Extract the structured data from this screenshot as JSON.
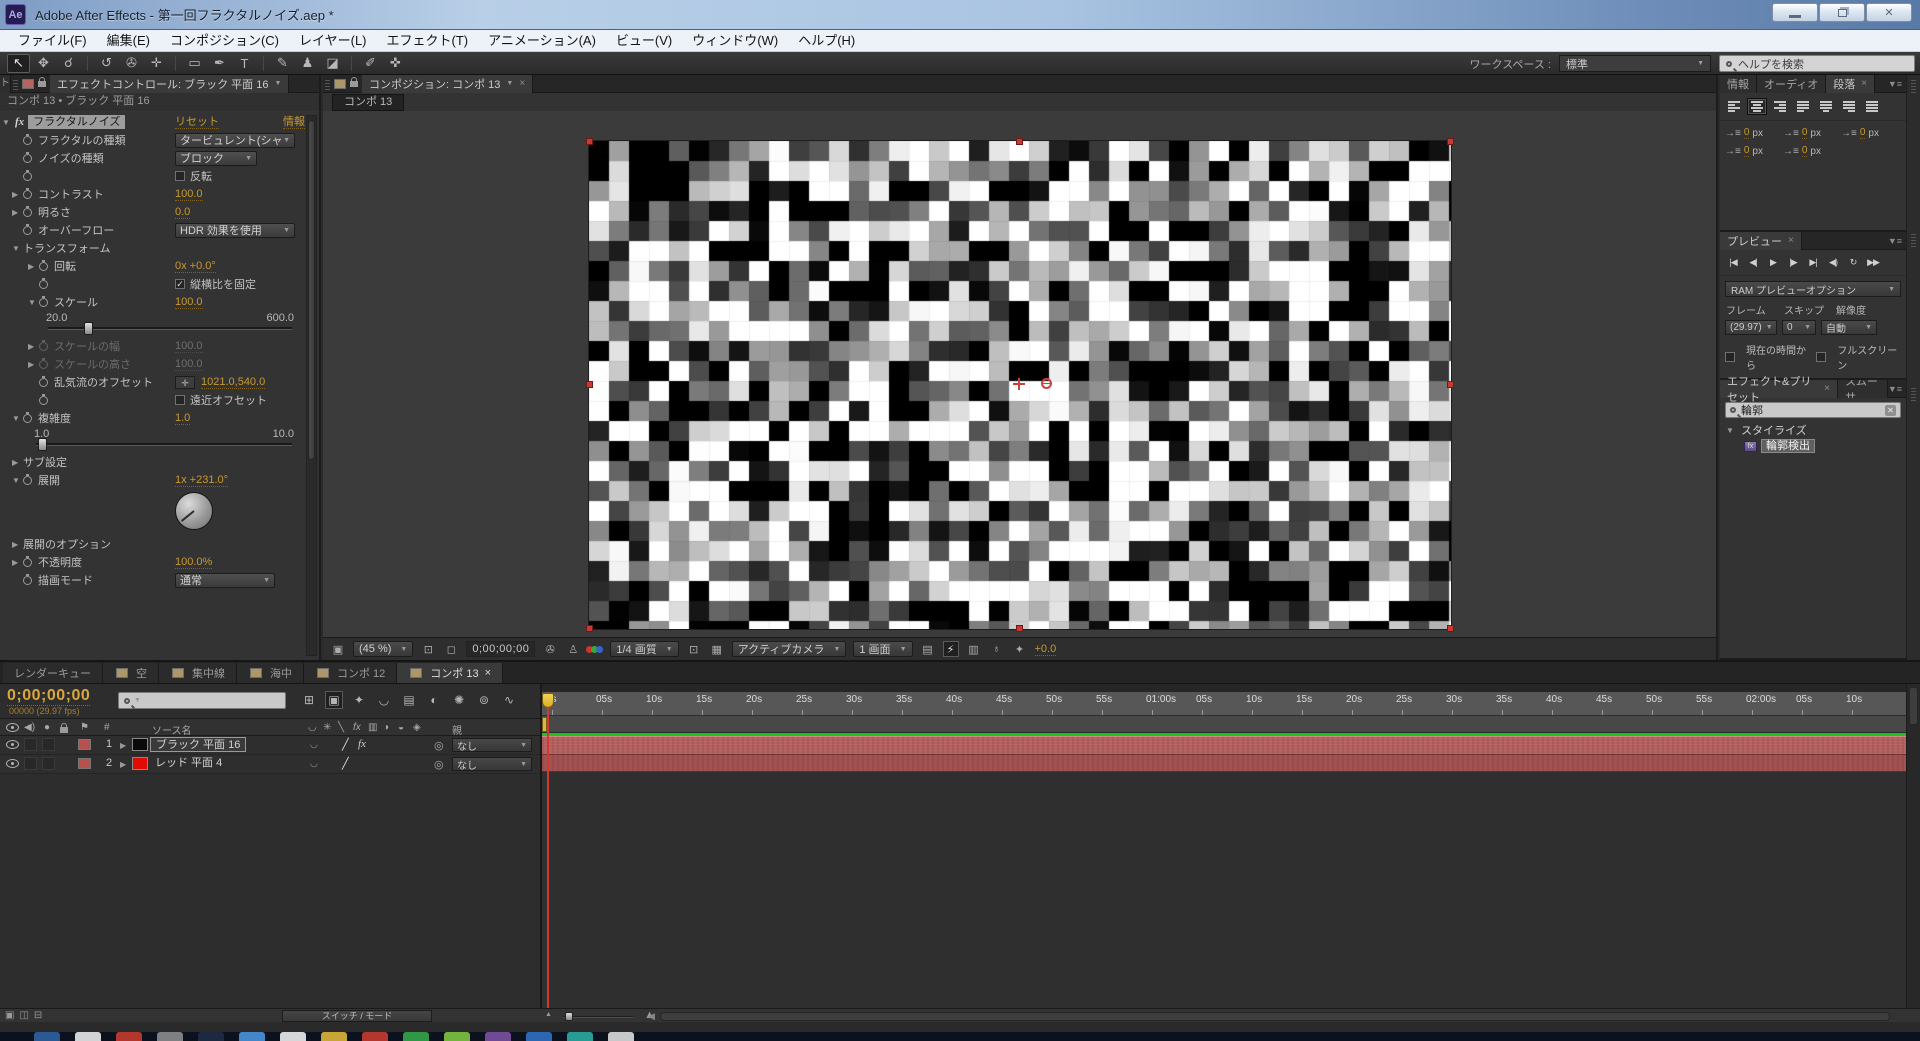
{
  "window": {
    "title": "Adobe After Effects - 第一回フラクタルノイズ.aep *"
  },
  "menu": {
    "items": [
      {
        "name": "menu-file",
        "label": "ファイル(F)"
      },
      {
        "name": "menu-edit",
        "label": "編集(E)"
      },
      {
        "name": "menu-composition",
        "label": "コンポジション(C)"
      },
      {
        "name": "menu-layer",
        "label": "レイヤー(L)"
      },
      {
        "name": "menu-effect",
        "label": "エフェクト(T)"
      },
      {
        "name": "menu-animation",
        "label": "アニメーション(A)"
      },
      {
        "name": "menu-view",
        "label": "ビュー(V)"
      },
      {
        "name": "menu-window",
        "label": "ウィンドウ(W)"
      },
      {
        "name": "menu-help",
        "label": "ヘルプ(H)"
      }
    ]
  },
  "toolbar": {
    "tools": [
      {
        "name": "selection-tool",
        "glyph": "↖",
        "active": true
      },
      {
        "name": "hand-tool",
        "glyph": "✥"
      },
      {
        "name": "zoom-tool",
        "glyph": "☌"
      },
      {
        "name": "rotation-tool",
        "glyph": "↺"
      },
      {
        "name": "unified-camera-tool",
        "glyph": "✇"
      },
      {
        "name": "pan-behind-tool",
        "glyph": "✛"
      },
      {
        "name": "shape-tool",
        "glyph": "▭"
      },
      {
        "name": "pen-tool",
        "glyph": "✒"
      },
      {
        "name": "type-tool",
        "glyph": "T"
      },
      {
        "name": "brush-tool",
        "glyph": "✎"
      },
      {
        "name": "clone-stamp-tool",
        "glyph": "♟"
      },
      {
        "name": "eraser-tool",
        "glyph": "◪"
      },
      {
        "name": "roto-brush-tool",
        "glyph": "✐"
      },
      {
        "name": "puppet-pin-tool",
        "glyph": "✜"
      }
    ],
    "workspace_label": "ワークスペース :",
    "workspace_value": "標準",
    "help_search_placeholder": "ヘルプを検索"
  },
  "ec": {
    "project_tab_fragment": "ト",
    "tab": "エフェクトコントロール: ブラック 平面 16",
    "breadcrumb": "コンポ 13 • ブラック 平面 16",
    "fx_badge": "fx",
    "effect_name": "フラクタルノイズ",
    "reset": "リセット",
    "about": "情報",
    "rows": {
      "fractal_type": {
        "label": "フラクタルの種類",
        "value": "タービュレント(シャ"
      },
      "noise_type": {
        "label": "ノイズの種類",
        "value": "ブロック"
      },
      "invert": {
        "label": "反転"
      },
      "contrast": {
        "label": "コントラスト",
        "value": "100.0"
      },
      "brightness": {
        "label": "明るさ",
        "value": "0.0"
      },
      "overflow": {
        "label": "オーバーフロー",
        "value": "HDR 効果を使用"
      },
      "transform": {
        "label": "トランスフォーム"
      },
      "rotation": {
        "label": "回転",
        "value": "0x +0.0°"
      },
      "aspect": {
        "label": "縦横比を固定"
      },
      "scale": {
        "label": "スケール",
        "value": "100.0",
        "min": "20.0",
        "max": "600.0"
      },
      "scale_width": {
        "label": "スケールの幅",
        "value": "100.0"
      },
      "scale_height": {
        "label": "スケールの高さ",
        "value": "100.0"
      },
      "offset": {
        "label": "乱気流のオフセット",
        "value": "1021.0,540.0"
      },
      "perspective": {
        "label": "遠近オフセット"
      },
      "complexity": {
        "label": "複雑度",
        "value": "1.0",
        "min": "1.0",
        "max": "10.0"
      },
      "sub_settings": {
        "label": "サブ設定"
      },
      "evolution": {
        "label": "展開",
        "value": "1x +231.0°"
      },
      "evolution_options": {
        "label": "展開のオプション"
      },
      "opacity": {
        "label": "不透明度",
        "value": "100.0%"
      },
      "blend_mode": {
        "label": "描画モード",
        "value": "通常"
      }
    }
  },
  "comp": {
    "tab": "コンポジション: コンポ 13",
    "viewer_tab": "コンポ 13",
    "toolbar": [
      {
        "t": "ic",
        "name": "viewer-lock-icon",
        "g": "▣"
      },
      {
        "t": "dd",
        "name": "magnification-select",
        "v": "(45 %)"
      },
      {
        "t": "ic",
        "name": "safe-areas-icon",
        "g": "⊡"
      },
      {
        "t": "ic",
        "name": "mask-visibility-icon",
        "g": "◻"
      },
      {
        "t": "time",
        "name": "viewer-current-time",
        "v": "0;00;00;00"
      },
      {
        "t": "ic",
        "name": "snapshot-icon",
        "g": "✇"
      },
      {
        "t": "ic",
        "name": "show-snapshot-icon",
        "g": "♙"
      },
      {
        "t": "rgb",
        "name": "show-channel-icon"
      },
      {
        "t": "dd",
        "name": "resolution-select",
        "v": "1/4 画質"
      },
      {
        "t": "ic",
        "name": "region-of-interest-icon",
        "g": "⊡"
      },
      {
        "t": "ic",
        "name": "transparency-grid-icon",
        "g": "▦"
      },
      {
        "t": "dd",
        "name": "view-select",
        "v": "アクティブカメラ"
      },
      {
        "t": "dd",
        "name": "view-layout-select",
        "v": "1 画面"
      },
      {
        "t": "ic",
        "name": "grid-guides-icon",
        "g": "▤"
      },
      {
        "t": "ic",
        "name": "fast-previews-icon",
        "g": "⚡",
        "active": true
      },
      {
        "t": "ic",
        "name": "timeline-button-icon",
        "g": "▥"
      },
      {
        "t": "ic",
        "name": "flowchart-button-icon",
        "g": "♁"
      },
      {
        "t": "ic",
        "name": "reset-exposure-icon",
        "g": "✦"
      },
      {
        "t": "val",
        "name": "exposure-value",
        "v": "+0.0"
      }
    ]
  },
  "right": {
    "tabs": [
      {
        "name": "tab-info",
        "label": "情報"
      },
      {
        "name": "tab-audio",
        "label": "オーディオ"
      },
      {
        "name": "tab-paragraph",
        "label": "段落",
        "active": true
      }
    ],
    "paragraph": {
      "align_buttons": [
        "align-left",
        "align-center",
        "align-right",
        "justify-last-left",
        "justify-last-center",
        "justify-last-right",
        "justify-all"
      ],
      "active_align": 1,
      "fields": [
        {
          "name": "indent-left-field",
          "icon": "indent-left-icon",
          "value": "0",
          "unit": "px"
        },
        {
          "name": "indent-first-line-field",
          "icon": "indent-first-line-icon",
          "value": "0",
          "unit": "px"
        },
        {
          "name": "indent-right-field",
          "icon": "indent-right-icon",
          "value": "0",
          "unit": "px"
        },
        {
          "name": "space-before-field",
          "icon": "space-before-icon",
          "value": "0",
          "unit": "px"
        },
        {
          "name": "space-after-field",
          "icon": "space-after-icon",
          "value": "0",
          "unit": "px"
        }
      ]
    },
    "preview": {
      "tab": "プレビュー",
      "transport": [
        {
          "name": "first-frame-button",
          "glyph": "|◀"
        },
        {
          "name": "previous-frame-button",
          "glyph": "◀|"
        },
        {
          "name": "play-button",
          "glyph": "▶"
        },
        {
          "name": "next-frame-button",
          "glyph": "|▶"
        },
        {
          "name": "last-frame-button",
          "glyph": "▶|"
        },
        {
          "name": "audio-toggle-button",
          "glyph": "◀)"
        },
        {
          "name": "loop-button",
          "glyph": "↻"
        },
        {
          "name": "ram-preview-button",
          "glyph": "▶▶"
        }
      ],
      "ram_option": "RAM プレビューオプション",
      "frame_label": "フレーム",
      "skip_label": "スキップ",
      "resolution_label": "解像度",
      "frame_rate": "(29.97)",
      "skip_value": "0",
      "resolution_value": "自動",
      "from_current_label": "現在の時間から",
      "fullscreen_label": "フルスクリーン"
    },
    "effects": {
      "tab": "エフェクト&プリセット",
      "tab2": "スムーサ",
      "search_value": "輪郭",
      "category": "スタイライズ",
      "preset": "輪郭検出"
    }
  },
  "timeline": {
    "tabs": [
      {
        "name": "tab-render-queue",
        "label": "レンダーキュー",
        "chip": false
      },
      {
        "name": "tab-comp-sky",
        "label": "空",
        "chip": true
      },
      {
        "name": "tab-comp-speedlines",
        "label": "集中線",
        "chip": true
      },
      {
        "name": "tab-comp-undersea",
        "label": "海中",
        "chip": true
      },
      {
        "name": "tab-comp-12",
        "label": "コンポ 12",
        "chip": true
      },
      {
        "name": "tab-comp-13",
        "label": "コンポ 13",
        "chip": true,
        "active": true
      }
    ],
    "current_time": "0;00;00;00",
    "frame_info": "00000 (29.97 fps)",
    "toolbar_icons": [
      {
        "name": "composition-mini-flowchart-icon",
        "glyph": "⊞"
      },
      {
        "name": "live-update-icon",
        "glyph": "▣",
        "active": true
      },
      {
        "name": "draft-3d-icon",
        "glyph": "✦"
      },
      {
        "name": "hide-shy-layers-icon",
        "glyph": "◡"
      },
      {
        "name": "frame-blending-icon",
        "glyph": "▤"
      },
      {
        "name": "motion-blur-icon",
        "glyph": "◐"
      },
      {
        "name": "brainstorm-icon",
        "glyph": "✺"
      },
      {
        "name": "auto-keyframe-icon",
        "glyph": "⊚"
      },
      {
        "name": "graph-editor-icon",
        "glyph": "∿"
      }
    ],
    "columns": {
      "source": "ソース名",
      "parent": "親",
      "number": "#"
    },
    "switch_icons": [
      {
        "name": "shy-icon",
        "glyph": "◡"
      },
      {
        "name": "collapse-transformations-icon",
        "glyph": "✳"
      },
      {
        "name": "quality-icon",
        "glyph": "╲"
      },
      {
        "name": "fx-switch-icon",
        "glyph": "fx"
      },
      {
        "name": "frame-blend-icon",
        "glyph": "▥"
      },
      {
        "name": "motion-blur-switch-icon",
        "glyph": "◑"
      },
      {
        "name": "adjustment-layer-icon",
        "glyph": "◒"
      },
      {
        "name": "3d-layer-icon",
        "glyph": "◈"
      }
    ],
    "layers": [
      {
        "num": "1",
        "name": "ブラック 平面 16",
        "swatch": "#0a0a0a",
        "quality": "╱",
        "fx": "fx",
        "parent": "なし",
        "selected": true
      },
      {
        "num": "2",
        "name": "レッド 平面 4",
        "swatch": "#e00b02",
        "quality": "╱",
        "fx": "",
        "parent": "なし",
        "selected": false
      }
    ],
    "ruler_labels": [
      "0s",
      "05s",
      "10s",
      "15s",
      "20s",
      "25s",
      "30s",
      "35s",
      "40s",
      "45s",
      "50s",
      "55s",
      "01:00s",
      "05s",
      "10s",
      "15s",
      "20s",
      "25s",
      "30s",
      "35s",
      "40s",
      "45s",
      "50s",
      "55s",
      "02:00s",
      "05s",
      "10s"
    ],
    "switch_mode_label": "スイッチ / モード"
  },
  "taskbar": {
    "colors": [
      "#2f5f9e",
      "#e5e5e5",
      "#c23b2e",
      "#8a8a8a",
      "#1f2a44",
      "#4a90d9",
      "#e8e8e8",
      "#d8b23a",
      "#c23b2e",
      "#35a24a",
      "#7dc242",
      "#7a4f9e",
      "#2f6fbf",
      "#2aa8a0",
      "#d8d8d8"
    ]
  },
  "colors": {
    "param_yellow": "#c9992e",
    "layer_bar": "#b4605f",
    "cache_green": "#1dc31d",
    "selection_red": "#c53a33",
    "tab_chip": "#ac9768"
  }
}
